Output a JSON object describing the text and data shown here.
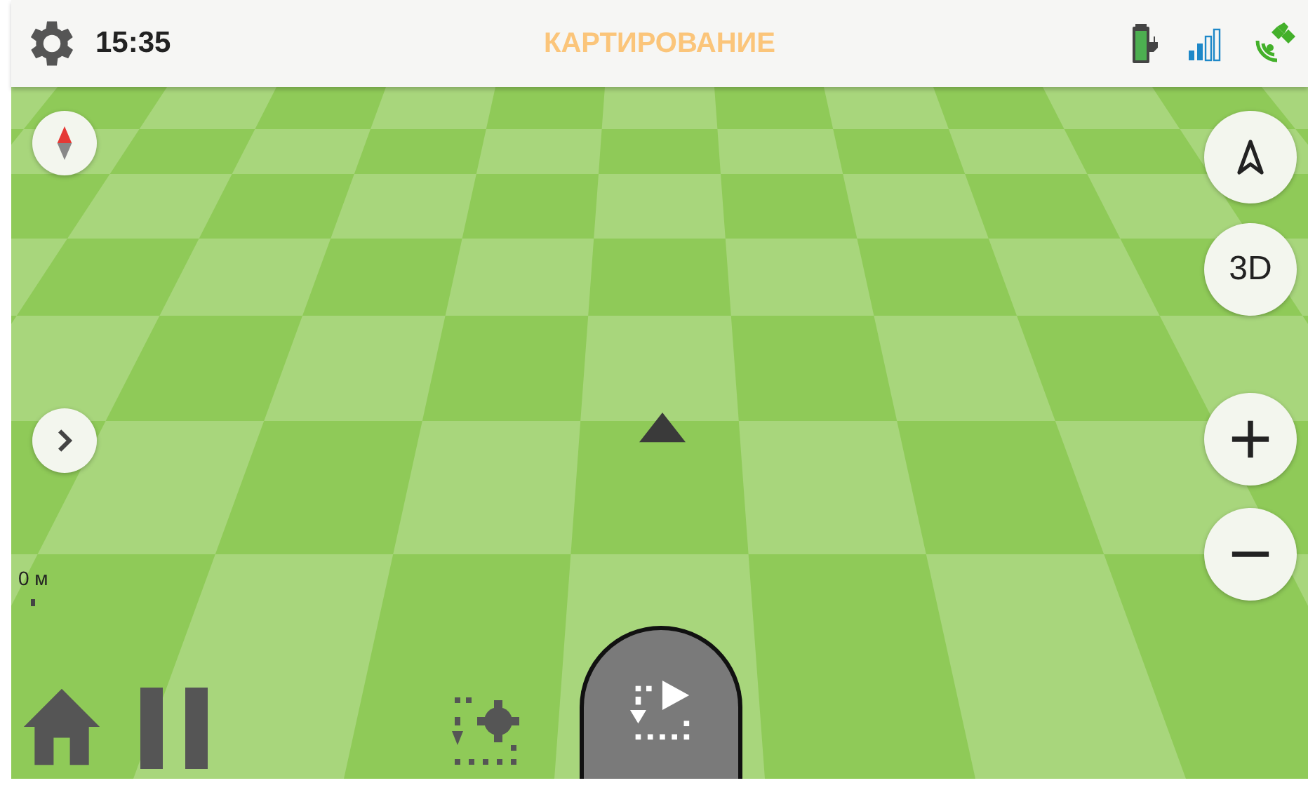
{
  "status_bar": {
    "time": "15:35",
    "title": "КАРТИРОВАНИЕ"
  },
  "map": {
    "view_mode_button": "3D",
    "scale_label": "0 м"
  }
}
